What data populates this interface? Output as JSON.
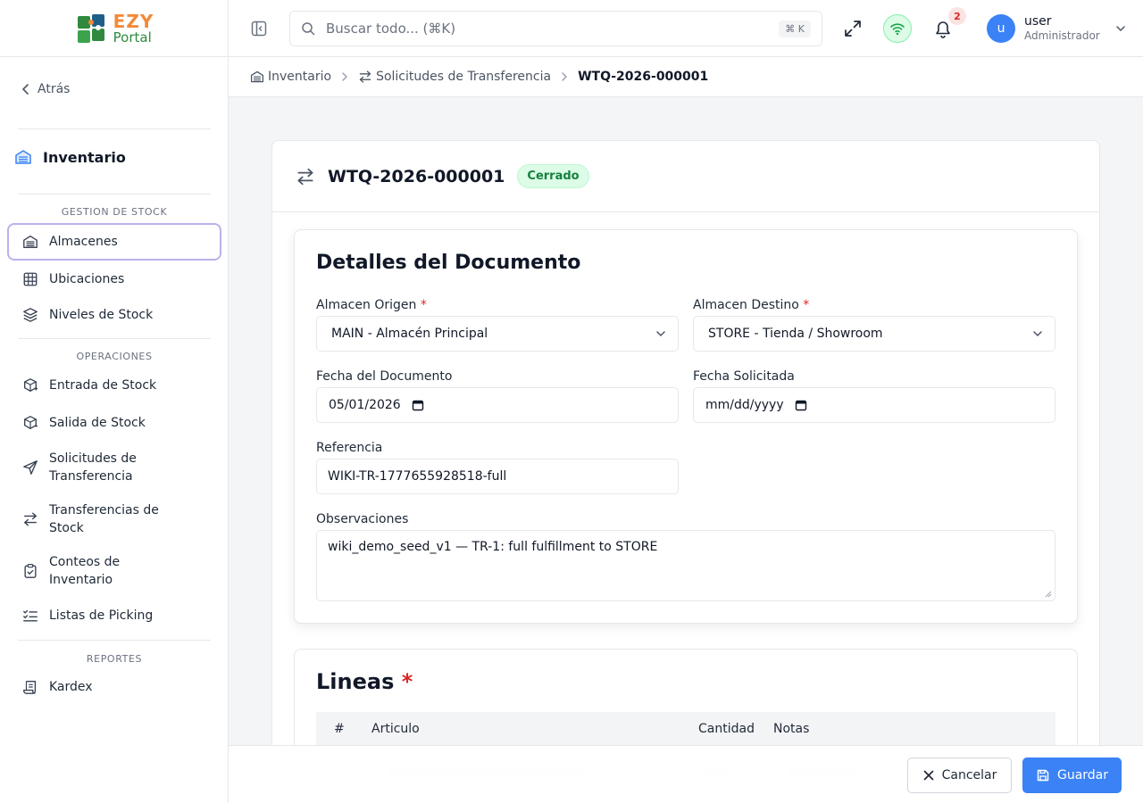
{
  "app": {
    "logo_top": "EZY",
    "logo_bottom": "Portal"
  },
  "sidebar": {
    "back_label": "Atrás",
    "section_title": "Inventario",
    "groups": [
      {
        "label": "GESTION DE STOCK"
      },
      {
        "label": "OPERACIONES"
      },
      {
        "label": "REPORTES"
      }
    ],
    "items": [
      {
        "label": "Almacenes",
        "icon": "warehouse-icon"
      },
      {
        "label": "Ubicaciones",
        "icon": "grid-icon"
      },
      {
        "label": "Niveles de Stock",
        "icon": "layers-icon"
      },
      {
        "label": "Entrada de Stock",
        "icon": "package-plus-icon"
      },
      {
        "label": "Salida de Stock",
        "icon": "package-minus-icon"
      },
      {
        "label": "Solicitudes de\nTransferencia",
        "line1": "Solicitudes de",
        "line2": "Transferencia",
        "icon": "send-icon"
      },
      {
        "label": "Transferencias de\nStock",
        "line1": "Transferencias de",
        "line2": "Stock",
        "icon": "arrows-exchange-icon"
      },
      {
        "label": "Conteos de\nInventario",
        "line1": "Conteos de",
        "line2": "Inventario",
        "icon": "clipboard-check-icon"
      },
      {
        "label": "Listas de Picking",
        "icon": "list-checks-icon"
      },
      {
        "label": "Kardex",
        "icon": "scroll-icon"
      }
    ]
  },
  "topbar": {
    "search_placeholder": "Buscar todo... (⌘K)",
    "search_shortcut": "⌘ K",
    "notification_count": "2",
    "user_initial": "u",
    "user_name": "user",
    "user_role": "Administrador"
  },
  "breadcrumb": {
    "items": [
      "Inventario",
      "Solicitudes de Transferencia"
    ],
    "current": "WTQ-2026-000001"
  },
  "document": {
    "id": "WTQ-2026-000001",
    "status": "Cerrado",
    "details_title": "Detalles del Documento",
    "fields": {
      "origin_label": "Almacen Origen",
      "origin_value": "MAIN - Almacén Principal",
      "dest_label": "Almacen Destino",
      "dest_value": "STORE - Tienda / Showroom",
      "doc_date_label": "Fecha del Documento",
      "doc_date_value": "05/01/2026",
      "req_date_label": "Fecha Solicitada",
      "req_date_value": "mm/dd/yyyy",
      "ref_label": "Referencia",
      "ref_value": "WIKI-TR-1777655928518-full",
      "notes_label": "Observaciones",
      "notes_value": "wiki_demo_seed_v1 — TR-1: full fulfillment to STORE"
    },
    "required_mark": "*"
  },
  "lines": {
    "title": "Lineas",
    "required_mark": "*",
    "headers": [
      "#",
      "Articulo",
      "Cantidad",
      "Notas"
    ]
  },
  "footer": {
    "cancel_label": "Cancelar",
    "save_label": "Guardar"
  },
  "colors": {
    "primary": "#3b82f6",
    "status_green": "#15803d",
    "active_border": "#b8b3ea",
    "logo_orange": "#f28a3a",
    "logo_green": "#2f8a3e"
  }
}
